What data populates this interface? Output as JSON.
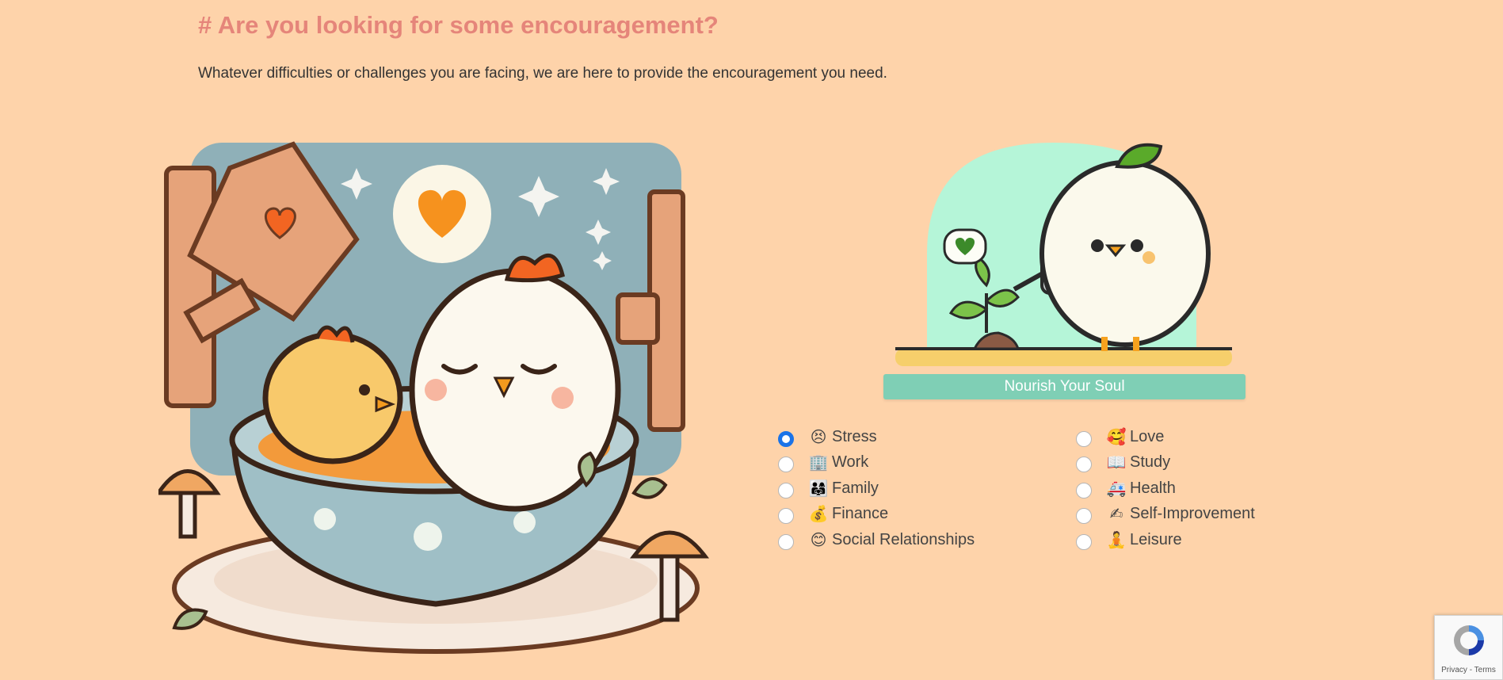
{
  "header": {
    "title": "# Are you looking for some encouragement?",
    "subtitle": "Whatever difficulties or challenges you are facing, we are here to provide the encouragement you need."
  },
  "hero": {
    "illustration": "two-chicks-in-bowl-illustration"
  },
  "card": {
    "illustration": "chick-watering-plant-illustration",
    "button_label": "Nourish Your Soul",
    "button_color": "#7fcfb5"
  },
  "topics": {
    "selected": "Stress",
    "left": [
      {
        "emoji": "😣",
        "label": "Stress",
        "checked": true
      },
      {
        "emoji": "🏢",
        "label": "Work",
        "checked": false
      },
      {
        "emoji": "👨‍👩‍👧",
        "label": "Family",
        "checked": false
      },
      {
        "emoji": "💰",
        "label": "Finance",
        "checked": false
      },
      {
        "emoji": "😊",
        "label": "Social Relationships",
        "checked": false
      }
    ],
    "right": [
      {
        "emoji": "🥰",
        "label": "Love",
        "checked": false
      },
      {
        "emoji": "📖",
        "label": "Study",
        "checked": false
      },
      {
        "emoji": "🚑",
        "label": "Health",
        "checked": false
      },
      {
        "emoji": "✍",
        "label": "Self-Improvement",
        "checked": false
      },
      {
        "emoji": "🧘",
        "label": "Leisure",
        "checked": false
      }
    ]
  },
  "recaptcha": {
    "links": "Privacy - Terms"
  },
  "colors": {
    "background": "#fed3aa",
    "title": "#e5857a",
    "radio_checked": "#1a73e8"
  }
}
